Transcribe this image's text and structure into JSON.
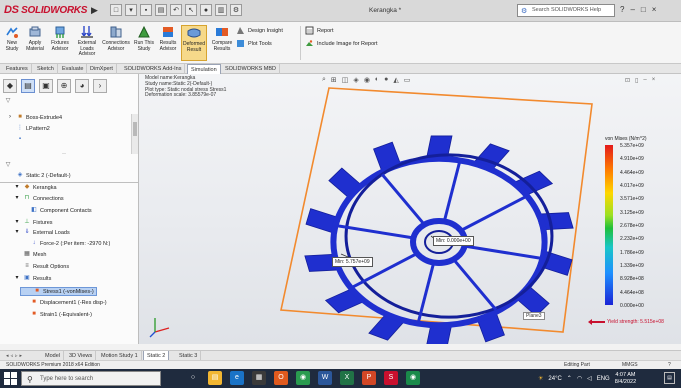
{
  "app": {
    "brand": "SOLIDWORKS",
    "brand_prefix": "DS",
    "document_title": "Kerangka *",
    "search_placeholder": "Search SOLIDWORKS Help",
    "help_label": "?",
    "window_controls": [
      "–",
      "□",
      "×"
    ]
  },
  "ribbon": {
    "buttons": [
      {
        "label": "New Study",
        "icon": "new-study-icon"
      },
      {
        "label": "Apply Material",
        "icon": "apply-material-icon"
      },
      {
        "label": "Fixtures Advisor",
        "icon": "fixtures-icon"
      },
      {
        "label": "External Loads Advisor",
        "icon": "external-loads-icon"
      },
      {
        "label": "Connections Advisor",
        "icon": "connections-icon"
      },
      {
        "label": "Run This Study",
        "icon": "run-study-icon"
      },
      {
        "label": "Results Advisor",
        "icon": "results-advisor-icon"
      },
      {
        "label": "Deformed Result",
        "icon": "deformed-result-icon"
      },
      {
        "label": "Compare Results",
        "icon": "compare-results-icon"
      }
    ],
    "small_buttons": [
      {
        "label": "Design Insight",
        "icon": "design-insight-icon"
      },
      {
        "label": "Plot Tools",
        "icon": "plot-tools-icon"
      },
      {
        "label": "Report",
        "icon": "report-icon"
      },
      {
        "label": "Include Image for Report",
        "icon": "include-image-icon"
      }
    ]
  },
  "command_tabs": [
    "Features",
    "Sketch",
    "Evaluate",
    "DimXpert",
    "SOLIDWORKS Add-Ins",
    "Simulation",
    "SOLIDWORKS MBD"
  ],
  "active_command_tab": "Simulation",
  "feature_tree_top": [
    {
      "label": "Boss-Extrude4",
      "icon": "boss-extrude-icon"
    },
    {
      "label": "LPattern2",
      "icon": "linear-pattern-icon"
    }
  ],
  "study_tree": [
    {
      "label": "Static 2 (-Default-)",
      "icon": "static-study-icon",
      "indent": 0
    },
    {
      "label": "Kerangka",
      "icon": "part-icon",
      "indent": 1
    },
    {
      "label": "Connections",
      "icon": "connections-icon",
      "indent": 1
    },
    {
      "label": "Component Contacts",
      "icon": "component-contacts-icon",
      "indent": 2
    },
    {
      "label": "Fixtures",
      "icon": "fixtures-icon",
      "indent": 1
    },
    {
      "label": "External Loads",
      "icon": "external-loads-icon",
      "indent": 1
    },
    {
      "label": "Force-2 (:Per item: -2970 N:)",
      "icon": "force-icon",
      "indent": 2
    },
    {
      "label": "Mesh",
      "icon": "mesh-icon",
      "indent": 1
    },
    {
      "label": "Result Options",
      "icon": "result-options-icon",
      "indent": 1
    },
    {
      "label": "Results",
      "icon": "results-folder-icon",
      "indent": 1
    },
    {
      "label": "Stress1 (-vonMises-)",
      "icon": "stress-plot-icon",
      "indent": 2,
      "selected": true
    },
    {
      "label": "Displacement1 (-Res disp-)",
      "icon": "displacement-plot-icon",
      "indent": 2
    },
    {
      "label": "Strain1 (-Equivalent-)",
      "icon": "strain-plot-icon",
      "indent": 2
    }
  ],
  "viewport": {
    "info_lines": [
      "Model name:Kerangka",
      "Study name:Static 2(-Default-)",
      "Plot type: Static nodal stress Stress1",
      "Deformation scale: 3.85579e-07"
    ],
    "probe_min": "Min: 5.757e+09",
    "probe_max": "Min: 0.000e+00",
    "plane_label": "Plane3",
    "colors": {
      "wheel": "#1f2fcf",
      "wheel_dark": "#141f9a",
      "frame": "#f28a2e"
    }
  },
  "legend": {
    "title": "von Mises (N/m^2)",
    "values": [
      "5.357e+09",
      "4.910e+09",
      "4.464e+09",
      "4.017e+09",
      "3.571e+09",
      "3.125e+09",
      "2.678e+09",
      "2.232e+09",
      "1.786e+09",
      "1.339e+09",
      "8.928e+08",
      "4.464e+08",
      "0.000e+00"
    ],
    "yield_label": "Yield strength: 5.515e+08"
  },
  "bottom_tabs": [
    "Model",
    "3D Views",
    "Motion Study 1",
    "Static 2",
    "Static 3"
  ],
  "active_bottom_tab": "Static 2",
  "status": {
    "left": "SOLIDWORKS Premium 2018 x64 Edition",
    "editing": "Editing Part",
    "units": "MMGS",
    "help": "?"
  },
  "taskbar": {
    "search_placeholder": "Type here to search",
    "weather": "24°C",
    "language": "ENG",
    "time": "4:07 AM",
    "date": "8/4/2022",
    "apps": [
      "task-view-icon",
      "file-explorer-icon",
      "edge-icon",
      "store-icon",
      "office-icon",
      "chrome-icon",
      "word-icon",
      "excel-icon",
      "powerpoint-icon",
      "solidworks-icon",
      "chrome-alt-icon"
    ]
  }
}
